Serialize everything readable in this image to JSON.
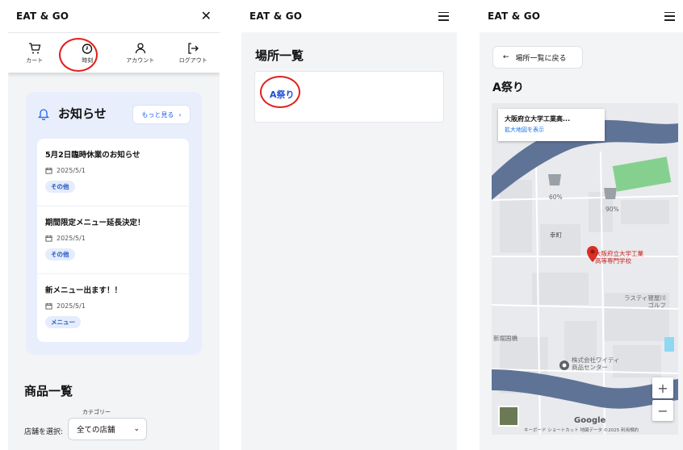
{
  "brand": "EAT & GO",
  "panel1": {
    "nav": [
      {
        "label": "カート",
        "icon": "cart-icon"
      },
      {
        "label": "時刻",
        "icon": "clock-icon"
      },
      {
        "label": "アカウント",
        "icon": "user-icon"
      },
      {
        "label": "ログアウト",
        "icon": "logout-icon"
      }
    ],
    "news": {
      "title": "お知らせ",
      "more": "もっと見る",
      "items": [
        {
          "title": "5月2日臨時休業のお知らせ",
          "date": "2025/5/1",
          "tag": "その他"
        },
        {
          "title": "期間限定メニュー延長決定！",
          "date": "2025/5/1",
          "tag": "その他"
        },
        {
          "title": "新メニュー出ます！！",
          "date": "2025/5/1",
          "tag": "メニュー"
        }
      ]
    },
    "products_title": "商品一覧",
    "category_label": "カテゴリー",
    "store_label": "店舗を選択:",
    "store_value": "全ての店舗"
  },
  "panel2": {
    "title": "場所一覧",
    "location": "A祭り"
  },
  "panel3": {
    "back": "場所一覧に戻る",
    "title": "A祭り",
    "map": {
      "place_name": "大阪府立大学工業高...",
      "enlarge": "拡大地図を表示",
      "bin1_pct": "60%",
      "bin2_pct": "90%",
      "label_town": "幸町",
      "label_school": "大阪府立大学工業\n高等専門学校",
      "label_sports": "ラスティ寝屋川\nゴルフ",
      "label_bridge": "新堀国橋",
      "label_company": "株式会社ワイティ\n商品センター",
      "google": "Google",
      "attribution": "キーボード ショートカット  地図データ ©2025  利用規約"
    }
  },
  "colors": {
    "accent": "#2563eb",
    "highlight": "#e0201b",
    "pin": "#d93025"
  }
}
